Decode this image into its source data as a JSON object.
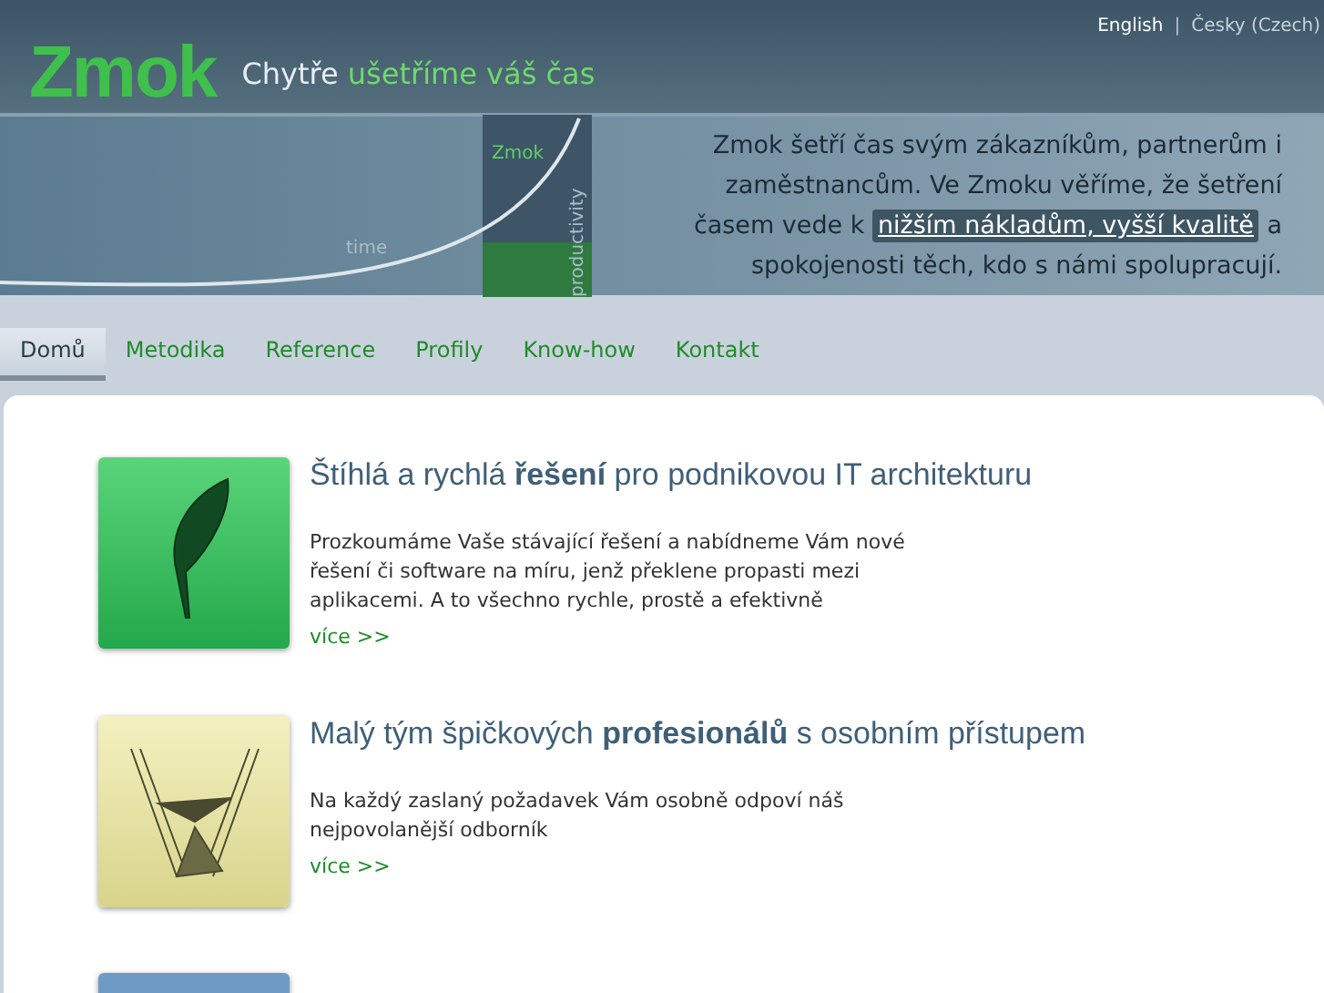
{
  "logo": {
    "text": "Zmok",
    "tagline_plain": "Chytře",
    "tagline_accent": "ušetříme váš čas"
  },
  "languages": [
    {
      "label": "English",
      "selected": true
    },
    {
      "label": "Česky (Czech)",
      "selected": false
    }
  ],
  "language_separator": "|",
  "hero": {
    "graph_labels": {
      "curve": "Zmok",
      "x": "time",
      "y": "productivity"
    },
    "intro": {
      "before": "Zmok šetří čas svým zákazníkům, partnerům i zaměstnancům. Ve Zmoku věříme, že šetření časem vede k",
      "link": "nižším nákladům, vyšší kvalitě",
      "after": "a spokojenosti těch, kdo s námi spolupracují."
    }
  },
  "nav": [
    {
      "label": "Domů",
      "selected": true
    },
    {
      "label": "Metodika",
      "selected": false
    },
    {
      "label": "Reference",
      "selected": false
    },
    {
      "label": "Profily",
      "selected": false
    },
    {
      "label": "Know-how",
      "selected": false
    },
    {
      "label": "Kontakt",
      "selected": false
    }
  ],
  "features": [
    {
      "kind": "feather",
      "title": "Štíhlá a rychlá **řešení** pro podnikovou IT architekturu",
      "text": "Prozkoumáme Vaše stávající řešení a nabídneme Vám nové řešení či software na míru, jenž překlene propasti mezi aplikacemi. A to všechno rychle, prostě a efektivně",
      "more": "více >>"
    },
    {
      "kind": "engraving",
      "title": "Malý tým špičkových **profesionálů** s osobním přístupem",
      "text": "Na každý zaslaný požadavek Vám osobně odpoví náš nejpovolanější odborník",
      "more": "více >>"
    },
    {
      "kind": "blue"
    }
  ]
}
